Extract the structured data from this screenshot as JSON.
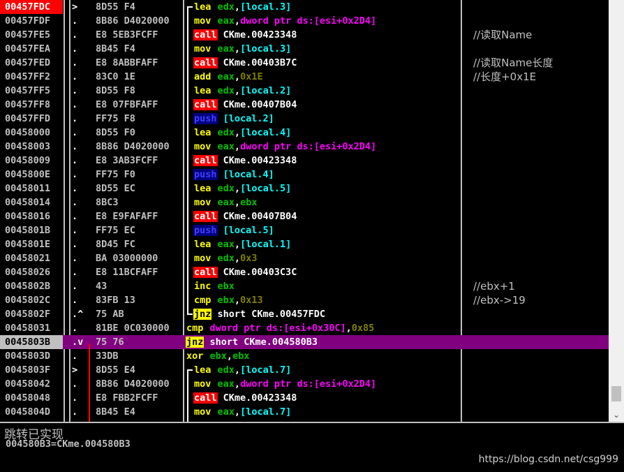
{
  "rows": [
    {
      "addr": "00457FDC",
      "mark": ">",
      "hex": "8D55 F4",
      "mn": "lea",
      "ops": [
        [
          "edx",
          "reg"
        ],
        [
          ",",
          "plain"
        ],
        [
          "[local.3]",
          "mem"
        ]
      ],
      "cmt": "",
      "addr_style": "hl",
      "bracket": "top"
    },
    {
      "addr": "00457FDF",
      "mark": ".",
      "hex": "8B86 D4020000",
      "mn": "mov",
      "ops": [
        [
          "eax",
          "reg"
        ],
        [
          ",",
          "plain"
        ],
        [
          "dword ptr ds:[esi+0x2D4]",
          "ptr"
        ]
      ],
      "cmt": ""
    },
    {
      "addr": "00457FE5",
      "mark": ".",
      "hex": "E8 5EB3FCFF",
      "mn": "call",
      "ops": [
        [
          "CKme.00423348",
          "plain"
        ]
      ],
      "cmt": "//读取Name"
    },
    {
      "addr": "00457FEA",
      "mark": ".",
      "hex": "8B45 F4",
      "mn": "mov",
      "ops": [
        [
          "eax",
          "reg"
        ],
        [
          ",",
          "plain"
        ],
        [
          "[local.3]",
          "mem"
        ]
      ],
      "cmt": ""
    },
    {
      "addr": "00457FED",
      "mark": ".",
      "hex": "E8 8ABBFAFF",
      "mn": "call",
      "ops": [
        [
          "CKme.00403B7C",
          "plain"
        ]
      ],
      "cmt": "//读取Name长度"
    },
    {
      "addr": "00457FF2",
      "mark": ".",
      "hex": "83C0 1E",
      "mn": "add",
      "ops": [
        [
          "eax",
          "reg"
        ],
        [
          ",",
          "plain"
        ],
        [
          "0x1E",
          "imm"
        ]
      ],
      "cmt": "//长度+0x1E"
    },
    {
      "addr": "00457FF5",
      "mark": ".",
      "hex": "8D55 F8",
      "mn": "lea",
      "ops": [
        [
          "edx",
          "reg"
        ],
        [
          ",",
          "plain"
        ],
        [
          "[local.2]",
          "mem"
        ]
      ],
      "cmt": ""
    },
    {
      "addr": "00457FF8",
      "mark": ".",
      "hex": "E8 07FBFAFF",
      "mn": "call",
      "ops": [
        [
          "CKme.00407B04",
          "plain"
        ]
      ],
      "cmt": ""
    },
    {
      "addr": "00457FFD",
      "mark": ".",
      "hex": "FF75 F8",
      "mn": "push",
      "ops": [
        [
          "[local.2]",
          "mem"
        ]
      ],
      "cmt": ""
    },
    {
      "addr": "00458000",
      "mark": ".",
      "hex": "8D55 F0",
      "mn": "lea",
      "ops": [
        [
          "edx",
          "reg"
        ],
        [
          ",",
          "plain"
        ],
        [
          "[local.4]",
          "mem"
        ]
      ],
      "cmt": ""
    },
    {
      "addr": "00458003",
      "mark": ".",
      "hex": "8B86 D4020000",
      "mn": "mov",
      "ops": [
        [
          "eax",
          "reg"
        ],
        [
          ",",
          "plain"
        ],
        [
          "dword ptr ds:[esi+0x2D4]",
          "ptr"
        ]
      ],
      "cmt": ""
    },
    {
      "addr": "00458009",
      "mark": ".",
      "hex": "E8 3AB3FCFF",
      "mn": "call",
      "ops": [
        [
          "CKme.00423348",
          "plain"
        ]
      ],
      "cmt": ""
    },
    {
      "addr": "0045800E",
      "mark": ".",
      "hex": "FF75 F0",
      "mn": "push",
      "ops": [
        [
          "[local.4]",
          "mem"
        ]
      ],
      "cmt": ""
    },
    {
      "addr": "00458011",
      "mark": ".",
      "hex": "8D55 EC",
      "mn": "lea",
      "ops": [
        [
          "edx",
          "reg"
        ],
        [
          ",",
          "plain"
        ],
        [
          "[local.5]",
          "mem"
        ]
      ],
      "cmt": ""
    },
    {
      "addr": "00458014",
      "mark": ".",
      "hex": "8BC3",
      "mn": "mov",
      "ops": [
        [
          "eax",
          "reg"
        ],
        [
          ",",
          "plain"
        ],
        [
          "ebx",
          "reg"
        ]
      ],
      "cmt": ""
    },
    {
      "addr": "00458016",
      "mark": ".",
      "hex": "E8 E9FAFAFF",
      "mn": "call",
      "ops": [
        [
          "CKme.00407B04",
          "plain"
        ]
      ],
      "cmt": ""
    },
    {
      "addr": "0045801B",
      "mark": ".",
      "hex": "FF75 EC",
      "mn": "push",
      "ops": [
        [
          "[local.5]",
          "mem"
        ]
      ],
      "cmt": ""
    },
    {
      "addr": "0045801E",
      "mark": ".",
      "hex": "8D45 FC",
      "mn": "lea",
      "ops": [
        [
          "eax",
          "reg"
        ],
        [
          ",",
          "plain"
        ],
        [
          "[local.1]",
          "mem"
        ]
      ],
      "cmt": ""
    },
    {
      "addr": "00458021",
      "mark": ".",
      "hex": "BA 03000000",
      "mn": "mov",
      "ops": [
        [
          "edx",
          "reg"
        ],
        [
          ",",
          "plain"
        ],
        [
          "0x3",
          "imm"
        ]
      ],
      "cmt": ""
    },
    {
      "addr": "00458026",
      "mark": ".",
      "hex": "E8 11BCFAFF",
      "mn": "call",
      "ops": [
        [
          "CKme.00403C3C",
          "plain"
        ]
      ],
      "cmt": ""
    },
    {
      "addr": "0045802B",
      "mark": ".",
      "hex": "43",
      "mn": "inc",
      "ops": [
        [
          "ebx",
          "reg"
        ]
      ],
      "cmt": "//ebx+1"
    },
    {
      "addr": "0045802C",
      "mark": ".",
      "hex": "83FB 13",
      "mn": "cmp",
      "ops": [
        [
          "ebx",
          "reg"
        ],
        [
          ",",
          "plain"
        ],
        [
          "0x13",
          "imm"
        ]
      ],
      "cmt": "//ebx->19"
    },
    {
      "addr": "0045802F",
      "mark": ".^",
      "hex": "75 AB",
      "mn": "jnz",
      "ops": [
        [
          "short CKme.00457FDC",
          "plain"
        ]
      ],
      "cmt": "",
      "bracket": "bottom"
    },
    {
      "addr": "00458031",
      "mark": ".",
      "hex": "81BE 0C030000",
      "mn": "cmp",
      "ops": [
        [
          "dword ptr ds:[esi+0x30C]",
          "ptr"
        ],
        [
          ",",
          "plain"
        ],
        [
          "0x85",
          "imm"
        ]
      ],
      "cmt": "",
      "asm_shift": true
    },
    {
      "addr": "0045803B",
      "mark": ".v",
      "hex": "75 76",
      "mn": "jnz",
      "ops": [
        [
          "short CKme.004580B3",
          "plain"
        ]
      ],
      "cmt": "",
      "addr_style": "selh",
      "selected": true,
      "asm_shift": true
    },
    {
      "addr": "0045803D",
      "mark": ".",
      "hex": "33DB",
      "mn": "xor",
      "ops": [
        [
          "ebx",
          "reg"
        ],
        [
          ",",
          "plain"
        ],
        [
          "ebx",
          "reg"
        ]
      ],
      "cmt": "",
      "asm_shift": true
    },
    {
      "addr": "0045803F",
      "mark": ">",
      "hex": "8D55 E4",
      "mn": "lea",
      "ops": [
        [
          "edx",
          "reg"
        ],
        [
          ",",
          "plain"
        ],
        [
          "[local.7]",
          "mem"
        ]
      ],
      "cmt": "",
      "bracket": "top"
    },
    {
      "addr": "00458042",
      "mark": ".",
      "hex": "8B86 D4020000",
      "mn": "mov",
      "ops": [
        [
          "eax",
          "reg"
        ],
        [
          ",",
          "plain"
        ],
        [
          "dword ptr ds:[esi+0x2D4]",
          "ptr"
        ]
      ],
      "cmt": ""
    },
    {
      "addr": "00458048",
      "mark": ".",
      "hex": "E8 FBB2FCFF",
      "mn": "call",
      "ops": [
        [
          "CKme.00423348",
          "plain"
        ]
      ],
      "cmt": ""
    },
    {
      "addr": "0045804D",
      "mark": ".",
      "hex": "8B45 E4",
      "mn": "mov",
      "ops": [
        [
          "eax",
          "reg"
        ],
        [
          ",",
          "plain"
        ],
        [
          "[local.7]",
          "mem"
        ]
      ],
      "cmt": ""
    }
  ],
  "info": {
    "line1": "跳转已实现",
    "line2": "004580B3=CKme.004580B3"
  },
  "watermark": "https://blog.csdn.net/csg999",
  "scroll_down_glyph": "⌄",
  "colors": {
    "call_bg": "#ff0000",
    "jnz_bg": "#ffff00",
    "selected_row": "#800080",
    "current_addr": "#ff0000"
  }
}
